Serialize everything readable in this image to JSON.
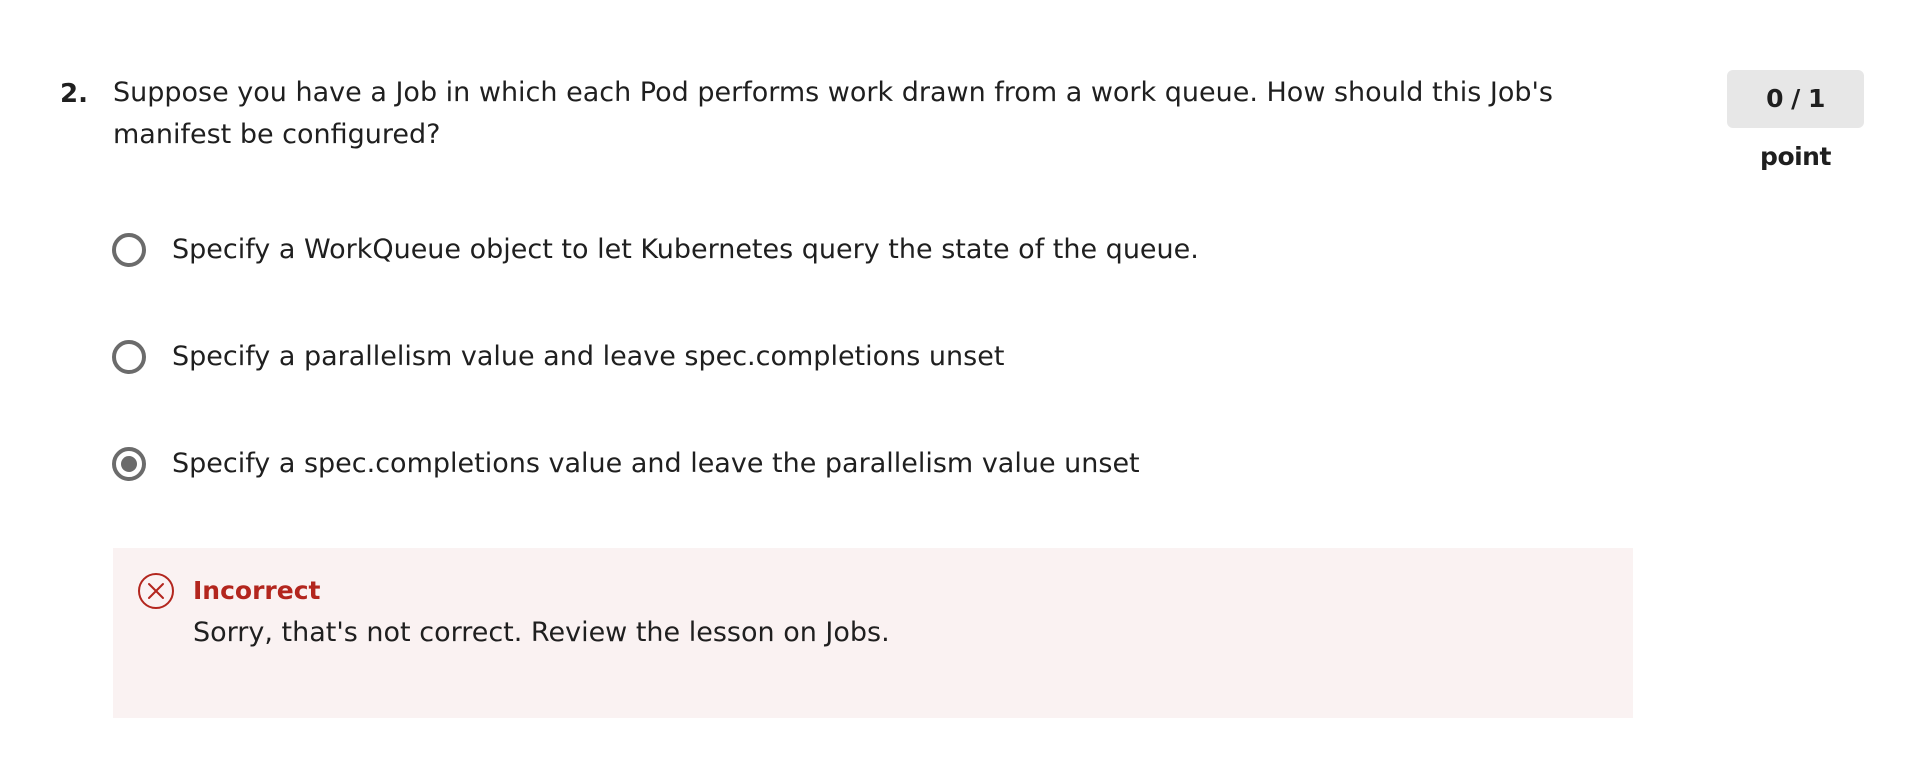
{
  "question": {
    "number": "2.",
    "text": "Suppose you have a Job in which each Pod performs work drawn from a work queue. How should this Job's manifest be configured?",
    "points": "0 / 1 point"
  },
  "options": [
    {
      "label": "Specify a WorkQueue object to let Kubernetes query the state of the queue.",
      "selected": false
    },
    {
      "label": "Specify a parallelism value and leave spec.completions unset",
      "selected": false
    },
    {
      "label": "Specify a spec.completions value and leave the parallelism value unset",
      "selected": true
    }
  ],
  "feedback": {
    "status": "Incorrect",
    "message": "Sorry, that's not correct. Review the lesson on Jobs.",
    "icon": "x-circle-icon",
    "color": "#b3261e",
    "background": "#faf2f2"
  },
  "colors": {
    "text": "#1f1f1f",
    "radio": "#6b6b6b",
    "badge_bg": "#e7e7e7"
  }
}
